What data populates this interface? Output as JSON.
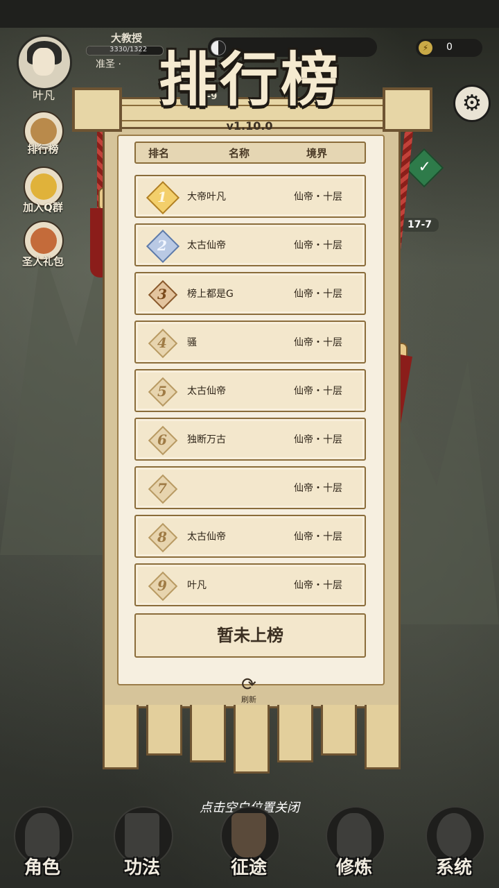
{
  "header": {
    "player_name": "叶凡",
    "title": "大教授",
    "xp_text": "3330/1322",
    "xp_ratio": 0.72,
    "realm_label": "准圣 ·",
    "coins": "0"
  },
  "stage_nodes": {
    "current": "17-9",
    "right": "17-7"
  },
  "side_menu": [
    {
      "label": "排行榜",
      "icon": "ranking-scroll-icon"
    },
    {
      "label": "加入Q群",
      "icon": "qq-penguin-icon"
    },
    {
      "label": "圣人礼包",
      "icon": "gift-box-icon"
    }
  ],
  "leaderboard": {
    "title": "排行榜",
    "version": "v1.10.0",
    "columns": [
      "排名",
      "名称",
      "境界"
    ],
    "rows": [
      {
        "rank": "1",
        "name": "大帝叶凡",
        "realm": "仙帝・十层",
        "tier": "gold"
      },
      {
        "rank": "2",
        "name": "太古仙帝",
        "realm": "仙帝・十层",
        "tier": "silver"
      },
      {
        "rank": "3",
        "name": "榜上都是G",
        "realm": "仙帝・十层",
        "tier": "bronze"
      },
      {
        "rank": "4",
        "name": "骚",
        "realm": "仙帝・十层",
        "tier": "plain"
      },
      {
        "rank": "5",
        "name": "太古仙帝",
        "realm": "仙帝・十层",
        "tier": "plain"
      },
      {
        "rank": "6",
        "name": "独断万古",
        "realm": "仙帝・十层",
        "tier": "plain"
      },
      {
        "rank": "7",
        "name": "",
        "realm": "仙帝・十层",
        "tier": "plain"
      },
      {
        "rank": "8",
        "name": "太古仙帝",
        "realm": "仙帝・十层",
        "tier": "plain"
      },
      {
        "rank": "9",
        "name": "叶凡",
        "realm": "仙帝・十层",
        "tier": "plain"
      }
    ],
    "self_status": "暂未上榜",
    "refresh_label": "刷新"
  },
  "hint": "点击空白位置关闭",
  "bottom_nav": [
    {
      "label": "角色",
      "icon": "character-icon"
    },
    {
      "label": "功法",
      "icon": "scripture-book-icon"
    },
    {
      "label": "征途",
      "icon": "sword-journey-icon",
      "active": true
    },
    {
      "label": "修炼",
      "icon": "meditation-icon"
    },
    {
      "label": "系统",
      "icon": "system-mascot-icon"
    }
  ]
}
